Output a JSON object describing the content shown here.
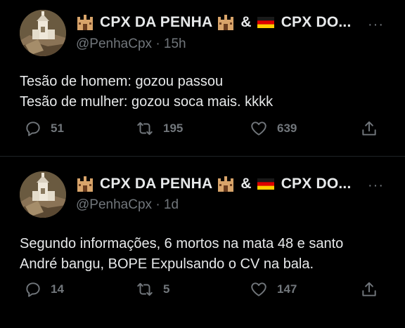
{
  "tweets": [
    {
      "display_name": "CPX DA PENHA",
      "amp": "&",
      "display_name_2": "CPX DO...",
      "handle": "@PenhaCpx",
      "dot": "·",
      "time": "15h",
      "text_lines": [
        "Tesão de homem: gozou passou",
        "Tesão de mulher: gozou soca mais. kkkk"
      ],
      "replies": "51",
      "retweets": "195",
      "likes": "639"
    },
    {
      "display_name": "CPX DA PENHA",
      "amp": "&",
      "display_name_2": "CPX DO...",
      "handle": "@PenhaCpx",
      "dot": "·",
      "time": "1d",
      "text_lines": [
        "Segundo informações, 6 mortos na mata 48 e santo",
        "André bangu, BOPE Expulsando o CV na bala."
      ],
      "replies": "14",
      "retweets": "5",
      "likes": "147"
    }
  ],
  "icons": {
    "castle": "castle-emoji-icon",
    "flag": "germany-flag-icon",
    "more": "more-icon",
    "reply": "reply-icon",
    "retweet": "retweet-icon",
    "like": "heart-icon",
    "share": "share-icon"
  },
  "more_glyph": "···",
  "colors": {
    "background": "#000000",
    "text": "#e7e9ea",
    "muted": "#71767b"
  }
}
